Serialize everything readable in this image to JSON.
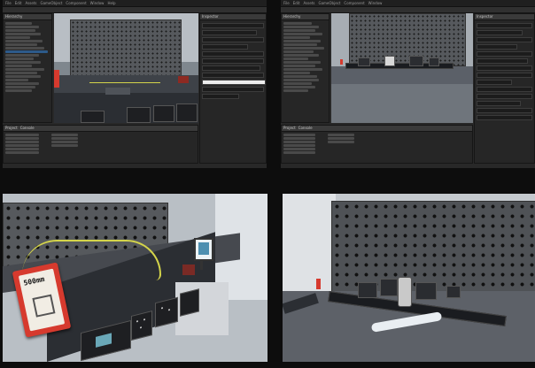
{
  "editor_menu": [
    "File",
    "Edit",
    "Assets",
    "GameObject",
    "Component",
    "Window",
    "Help"
  ],
  "panels": {
    "hierarchy_tab": "Hierarchy",
    "scene_tab": "Scene",
    "game_tab": "Game",
    "inspector_tab": "Inspector",
    "project_tab": "Project",
    "console_tab": "Console"
  },
  "sign_text": "500mm",
  "colors": {
    "editor_bg": "#282828",
    "pegboard": "#56595d",
    "bench": "#3e4248",
    "red_accent": "#d63a2e",
    "wire": "#d4d44a",
    "selection": "#2d5a8a"
  }
}
